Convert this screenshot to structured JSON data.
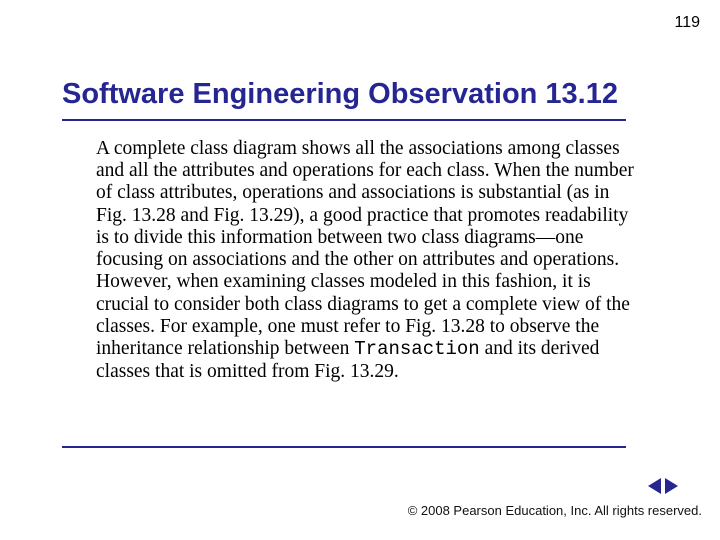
{
  "page_number": "119",
  "title": "Software Engineering Observation 13.12",
  "body": {
    "p1a": "A complete class diagram shows all the associations among classes and all the attributes and operations for each class. When the number of class attributes, operations and associations is substantial (as in Fig. 13.28 and Fig. 13.29), a good practice that promotes readability is to divide this information between two class diagrams—one focusing on associations and the other on attributes and operations. However, when examining classes modeled in this fashion, it is crucial to consider both class diagrams to get a complete view of the classes. For example, one must refer to Fig. 13.28 to observe the inheritance relationship between ",
    "code": "Transaction",
    "p1b": " and its derived classes that is omitted from Fig. 13.29."
  },
  "footer": {
    "copyright_symbol": "©",
    "text": " 2008 Pearson Education, Inc.  All rights reserved."
  },
  "nav": {
    "prev": "previous",
    "next": "next"
  }
}
